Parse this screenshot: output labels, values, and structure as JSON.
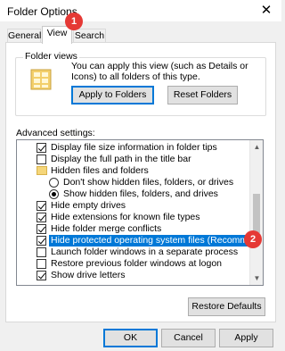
{
  "window": {
    "title": "Folder Options",
    "close_glyph": "✕"
  },
  "tabs": [
    {
      "label": "General"
    },
    {
      "label": "View"
    },
    {
      "label": "Search"
    }
  ],
  "folder_views": {
    "label": "Folder views",
    "description": "You can apply this view (such as Details or Icons) to all folders of this type.",
    "apply_label": "Apply to Folders",
    "reset_label": "Reset Folders"
  },
  "advanced": {
    "label": "Advanced settings:",
    "items": [
      {
        "type": "checkbox",
        "checked": true,
        "label": "Display file size information in folder tips",
        "indent": 1
      },
      {
        "type": "checkbox",
        "checked": false,
        "label": "Display the full path in the title bar",
        "indent": 1
      },
      {
        "type": "folder",
        "label": "Hidden files and folders",
        "indent": 1
      },
      {
        "type": "radio",
        "checked": false,
        "label": "Don't show hidden files, folders, or drives",
        "indent": 2
      },
      {
        "type": "radio",
        "checked": true,
        "label": "Show hidden files, folders, and drives",
        "indent": 2
      },
      {
        "type": "checkbox",
        "checked": true,
        "label": "Hide empty drives",
        "indent": 1
      },
      {
        "type": "checkbox",
        "checked": true,
        "label": "Hide extensions for known file types",
        "indent": 1
      },
      {
        "type": "checkbox",
        "checked": true,
        "label": "Hide folder merge conflicts",
        "indent": 1
      },
      {
        "type": "checkbox",
        "checked": true,
        "label": "Hide protected operating system files (Recommended)",
        "indent": 1,
        "selected": true
      },
      {
        "type": "checkbox",
        "checked": false,
        "label": "Launch folder windows in a separate process",
        "indent": 1
      },
      {
        "type": "checkbox",
        "checked": false,
        "label": "Restore previous folder windows at logon",
        "indent": 1
      },
      {
        "type": "checkbox",
        "checked": true,
        "label": "Show drive letters",
        "indent": 1
      }
    ],
    "restore_defaults_label": "Restore Defaults"
  },
  "footer": {
    "ok_label": "OK",
    "cancel_label": "Cancel",
    "apply_label": "Apply"
  },
  "annotations": [
    {
      "number": "1"
    },
    {
      "number": "2"
    }
  ],
  "colors": {
    "selection": "#0078d7",
    "badge": "#e53935"
  }
}
